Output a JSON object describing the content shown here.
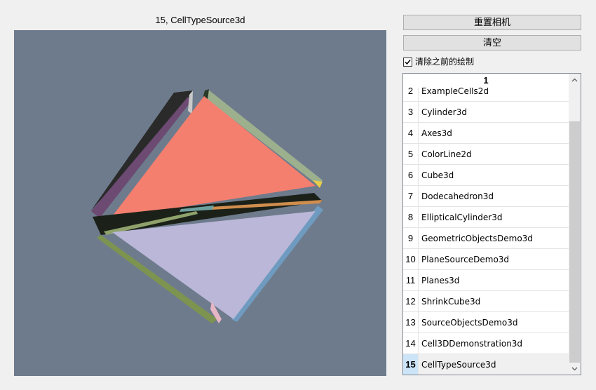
{
  "view": {
    "title": "15, CellTypeSource3d",
    "background_color": "#6e7b8c"
  },
  "controls": {
    "reset_camera_label": "重置相机",
    "clear_label": "清空",
    "clear_previous_label": "清除之前的绘制",
    "clear_previous_checked": true
  },
  "list": {
    "header": "1",
    "selected_index": 15,
    "items": [
      {
        "num": "2",
        "name": "ExampleCells2d"
      },
      {
        "num": "3",
        "name": "Cylinder3d"
      },
      {
        "num": "4",
        "name": "Axes3d"
      },
      {
        "num": "5",
        "name": "ColorLine2d"
      },
      {
        "num": "6",
        "name": "Cube3d"
      },
      {
        "num": "7",
        "name": "Dodecahedron3d"
      },
      {
        "num": "8",
        "name": "EllipticalCylinder3d"
      },
      {
        "num": "9",
        "name": "GeometricObjectsDemo3d"
      },
      {
        "num": "10",
        "name": "PlaneSourceDemo3d"
      },
      {
        "num": "11",
        "name": "Planes3d"
      },
      {
        "num": "12",
        "name": "ShrinkCube3d"
      },
      {
        "num": "13",
        "name": "SourceObjectsDemo3d"
      },
      {
        "num": "14",
        "name": "Cell3DDemonstration3d"
      },
      {
        "num": "15",
        "name": "CellTypeSource3d"
      }
    ]
  },
  "colors": {
    "top_face": "#f47f6f",
    "bottom_face": "#bab7d8",
    "left_upper": "#6c4a72",
    "right_upper": "#9cb08e",
    "left_lower": "#7d9450",
    "right_lower": "#6e9bbf",
    "dark_edge": "#1b2118"
  }
}
